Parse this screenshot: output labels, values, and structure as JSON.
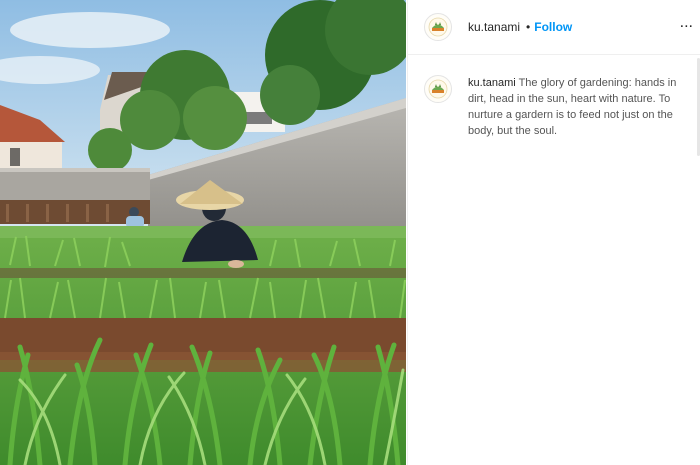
{
  "post": {
    "username": "ku.tanami",
    "separator": "•",
    "follow_label": "Follow",
    "more_label": "...",
    "caption": "The glory of gardening: hands in dirt, head in the sun, heart with nature. To nurture a gardern is to feed not just on the body, but the soul.",
    "avatar_icon": "farm-logo-icon",
    "more_icon": "more-options-icon"
  },
  "colors": {
    "accent": "#0095f6",
    "text": "#262626",
    "border": "#efefef"
  }
}
